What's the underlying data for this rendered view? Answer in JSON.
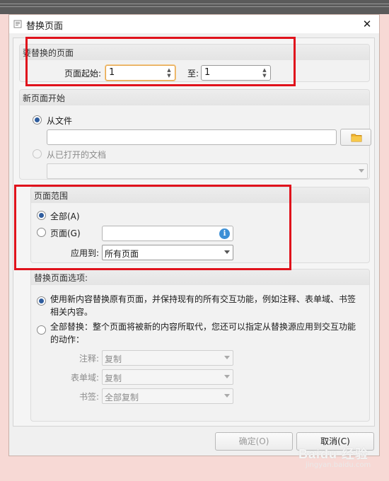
{
  "dialog": {
    "title": "替换页面",
    "close_glyph": "✕"
  },
  "replace_pages": {
    "group_title": "要替换的页面",
    "from_label": "页面起始:",
    "from_value": "1",
    "to_label": "至:",
    "to_value": "1"
  },
  "new_page_start": {
    "group_title": "新页面开始",
    "from_file_label": "从文件",
    "file_path_value": "",
    "from_open_doc_label": "从已打开的文档",
    "open_doc_value": ""
  },
  "page_range": {
    "group_title": "页面范围",
    "all_label": "全部(A)",
    "pages_label": "页面(G)",
    "pages_value": "",
    "info_glyph": "i",
    "apply_to_label": "应用到:",
    "apply_to_value": "所有页面"
  },
  "replace_options": {
    "group_title": "替换页面选项:",
    "option1_line1": "使用新内容替换原有页面，并保持现有的所有交互功能，例如注释、表单域、书签",
    "option1_line2": "相关内容。",
    "option2_line1": "全部替换：整个页面将被新的内容所取代，您还可以指定从替换源应用到交互功能",
    "option2_line2": "的动作：",
    "annotations_label": "注释:",
    "annotations_value": "复制",
    "form_fields_label": "表单域:",
    "form_fields_value": "复制",
    "bookmarks_label": "书签:",
    "bookmarks_value": "全部复制"
  },
  "buttons": {
    "ok_label": "确定(O)",
    "cancel_label": "取消(C)"
  },
  "watermark": {
    "text": "Baidu 经验",
    "subtext": "jingyan.baidu.com"
  },
  "colors": {
    "highlight": "#e0121c",
    "radio_selected": "#2f5d9e",
    "info_icon": "#3b8fd6",
    "background": "#f7d9d5"
  },
  "icons": {
    "folder": "folder-icon",
    "info": "info-icon",
    "close": "close-icon",
    "dropdown": "chevron-down-icon"
  }
}
